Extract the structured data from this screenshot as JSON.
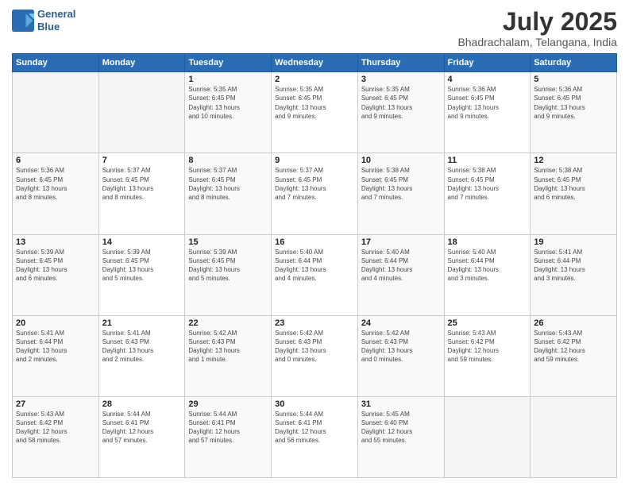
{
  "header": {
    "logo_line1": "General",
    "logo_line2": "Blue",
    "title": "July 2025",
    "subtitle": "Bhadrachalam, Telangana, India"
  },
  "weekdays": [
    "Sunday",
    "Monday",
    "Tuesday",
    "Wednesday",
    "Thursday",
    "Friday",
    "Saturday"
  ],
  "weeks": [
    [
      {
        "day": "",
        "info": ""
      },
      {
        "day": "",
        "info": ""
      },
      {
        "day": "1",
        "info": "Sunrise: 5:35 AM\nSunset: 6:45 PM\nDaylight: 13 hours\nand 10 minutes."
      },
      {
        "day": "2",
        "info": "Sunrise: 5:35 AM\nSunset: 6:45 PM\nDaylight: 13 hours\nand 9 minutes."
      },
      {
        "day": "3",
        "info": "Sunrise: 5:35 AM\nSunset: 6:45 PM\nDaylight: 13 hours\nand 9 minutes."
      },
      {
        "day": "4",
        "info": "Sunrise: 5:36 AM\nSunset: 6:45 PM\nDaylight: 13 hours\nand 9 minutes."
      },
      {
        "day": "5",
        "info": "Sunrise: 5:36 AM\nSunset: 6:45 PM\nDaylight: 13 hours\nand 9 minutes."
      }
    ],
    [
      {
        "day": "6",
        "info": "Sunrise: 5:36 AM\nSunset: 6:45 PM\nDaylight: 13 hours\nand 8 minutes."
      },
      {
        "day": "7",
        "info": "Sunrise: 5:37 AM\nSunset: 6:45 PM\nDaylight: 13 hours\nand 8 minutes."
      },
      {
        "day": "8",
        "info": "Sunrise: 5:37 AM\nSunset: 6:45 PM\nDaylight: 13 hours\nand 8 minutes."
      },
      {
        "day": "9",
        "info": "Sunrise: 5:37 AM\nSunset: 6:45 PM\nDaylight: 13 hours\nand 7 minutes."
      },
      {
        "day": "10",
        "info": "Sunrise: 5:38 AM\nSunset: 6:45 PM\nDaylight: 13 hours\nand 7 minutes."
      },
      {
        "day": "11",
        "info": "Sunrise: 5:38 AM\nSunset: 6:45 PM\nDaylight: 13 hours\nand 7 minutes."
      },
      {
        "day": "12",
        "info": "Sunrise: 5:38 AM\nSunset: 6:45 PM\nDaylight: 13 hours\nand 6 minutes."
      }
    ],
    [
      {
        "day": "13",
        "info": "Sunrise: 5:39 AM\nSunset: 6:45 PM\nDaylight: 13 hours\nand 6 minutes."
      },
      {
        "day": "14",
        "info": "Sunrise: 5:39 AM\nSunset: 6:45 PM\nDaylight: 13 hours\nand 5 minutes."
      },
      {
        "day": "15",
        "info": "Sunrise: 5:39 AM\nSunset: 6:45 PM\nDaylight: 13 hours\nand 5 minutes."
      },
      {
        "day": "16",
        "info": "Sunrise: 5:40 AM\nSunset: 6:44 PM\nDaylight: 13 hours\nand 4 minutes."
      },
      {
        "day": "17",
        "info": "Sunrise: 5:40 AM\nSunset: 6:44 PM\nDaylight: 13 hours\nand 4 minutes."
      },
      {
        "day": "18",
        "info": "Sunrise: 5:40 AM\nSunset: 6:44 PM\nDaylight: 13 hours\nand 3 minutes."
      },
      {
        "day": "19",
        "info": "Sunrise: 5:41 AM\nSunset: 6:44 PM\nDaylight: 13 hours\nand 3 minutes."
      }
    ],
    [
      {
        "day": "20",
        "info": "Sunrise: 5:41 AM\nSunset: 6:44 PM\nDaylight: 13 hours\nand 2 minutes."
      },
      {
        "day": "21",
        "info": "Sunrise: 5:41 AM\nSunset: 6:43 PM\nDaylight: 13 hours\nand 2 minutes."
      },
      {
        "day": "22",
        "info": "Sunrise: 5:42 AM\nSunset: 6:43 PM\nDaylight: 13 hours\nand 1 minute."
      },
      {
        "day": "23",
        "info": "Sunrise: 5:42 AM\nSunset: 6:43 PM\nDaylight: 13 hours\nand 0 minutes."
      },
      {
        "day": "24",
        "info": "Sunrise: 5:42 AM\nSunset: 6:43 PM\nDaylight: 13 hours\nand 0 minutes."
      },
      {
        "day": "25",
        "info": "Sunrise: 5:43 AM\nSunset: 6:42 PM\nDaylight: 12 hours\nand 59 minutes."
      },
      {
        "day": "26",
        "info": "Sunrise: 5:43 AM\nSunset: 6:42 PM\nDaylight: 12 hours\nand 59 minutes."
      }
    ],
    [
      {
        "day": "27",
        "info": "Sunrise: 5:43 AM\nSunset: 6:42 PM\nDaylight: 12 hours\nand 58 minutes."
      },
      {
        "day": "28",
        "info": "Sunrise: 5:44 AM\nSunset: 6:41 PM\nDaylight: 12 hours\nand 57 minutes."
      },
      {
        "day": "29",
        "info": "Sunrise: 5:44 AM\nSunset: 6:41 PM\nDaylight: 12 hours\nand 57 minutes."
      },
      {
        "day": "30",
        "info": "Sunrise: 5:44 AM\nSunset: 6:41 PM\nDaylight: 12 hours\nand 56 minutes."
      },
      {
        "day": "31",
        "info": "Sunrise: 5:45 AM\nSunset: 6:40 PM\nDaylight: 12 hours\nand 55 minutes."
      },
      {
        "day": "",
        "info": ""
      },
      {
        "day": "",
        "info": ""
      }
    ]
  ]
}
